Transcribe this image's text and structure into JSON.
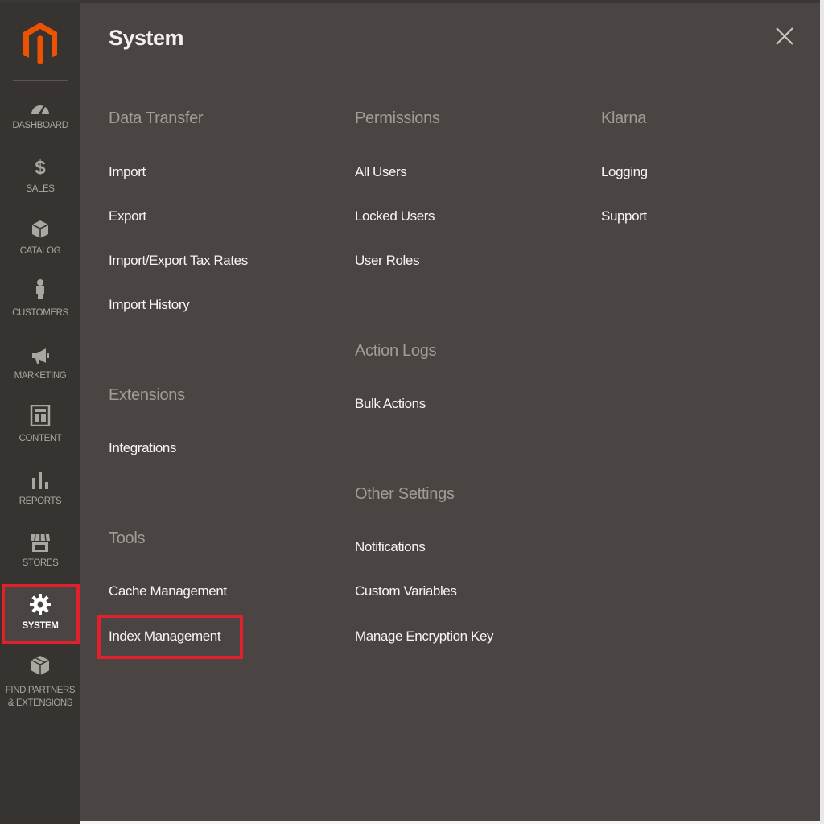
{
  "sidebar": {
    "items": [
      {
        "label": "DASHBOARD",
        "icon": "dashboard-icon"
      },
      {
        "label": "$ SALES",
        "icon": "dollar-icon"
      },
      {
        "label": "CATALOG",
        "icon": "box-icon"
      },
      {
        "label": "CUSTOMERS",
        "icon": "person-icon"
      },
      {
        "label": "MARKETING",
        "icon": "megaphone-icon"
      },
      {
        "label": "CONTENT",
        "icon": "layout-icon"
      },
      {
        "label": "REPORTS",
        "icon": "bar-chart-icon"
      },
      {
        "label": "STORES",
        "icon": "storefront-icon"
      },
      {
        "label": "SYSTEM",
        "icon": "gear-icon"
      },
      {
        "label": "FIND PARTNERS & EXTENSIONS",
        "icon": "cube-icon"
      }
    ],
    "active": "SYSTEM"
  },
  "flyout": {
    "title": "System",
    "close_icon": "close-icon",
    "columns": [
      {
        "groups": [
          {
            "title": "Data Transfer",
            "links": [
              "Import",
              "Export",
              "Import/Export Tax Rates",
              "Import History"
            ]
          },
          {
            "title": "Extensions",
            "links": [
              "Integrations"
            ]
          },
          {
            "title": "Tools",
            "links": [
              "Cache Management",
              "Index Management"
            ]
          }
        ]
      },
      {
        "groups": [
          {
            "title": "Permissions",
            "links": [
              "All Users",
              "Locked Users",
              "User Roles"
            ]
          },
          {
            "title": "Action Logs",
            "links": [
              "Bulk Actions"
            ]
          },
          {
            "title": "Other Settings",
            "links": [
              "Notifications",
              "Custom Variables",
              "Manage Encryption Key"
            ]
          }
        ]
      },
      {
        "groups": [
          {
            "title": "Klarna",
            "links": [
              "Logging",
              "Support"
            ]
          }
        ]
      }
    ]
  },
  "colors": {
    "sidebar_bg": "#373330",
    "flyout_bg": "#4a4542",
    "brand_orange": "#eb5202",
    "highlight_red": "#e0202a"
  }
}
